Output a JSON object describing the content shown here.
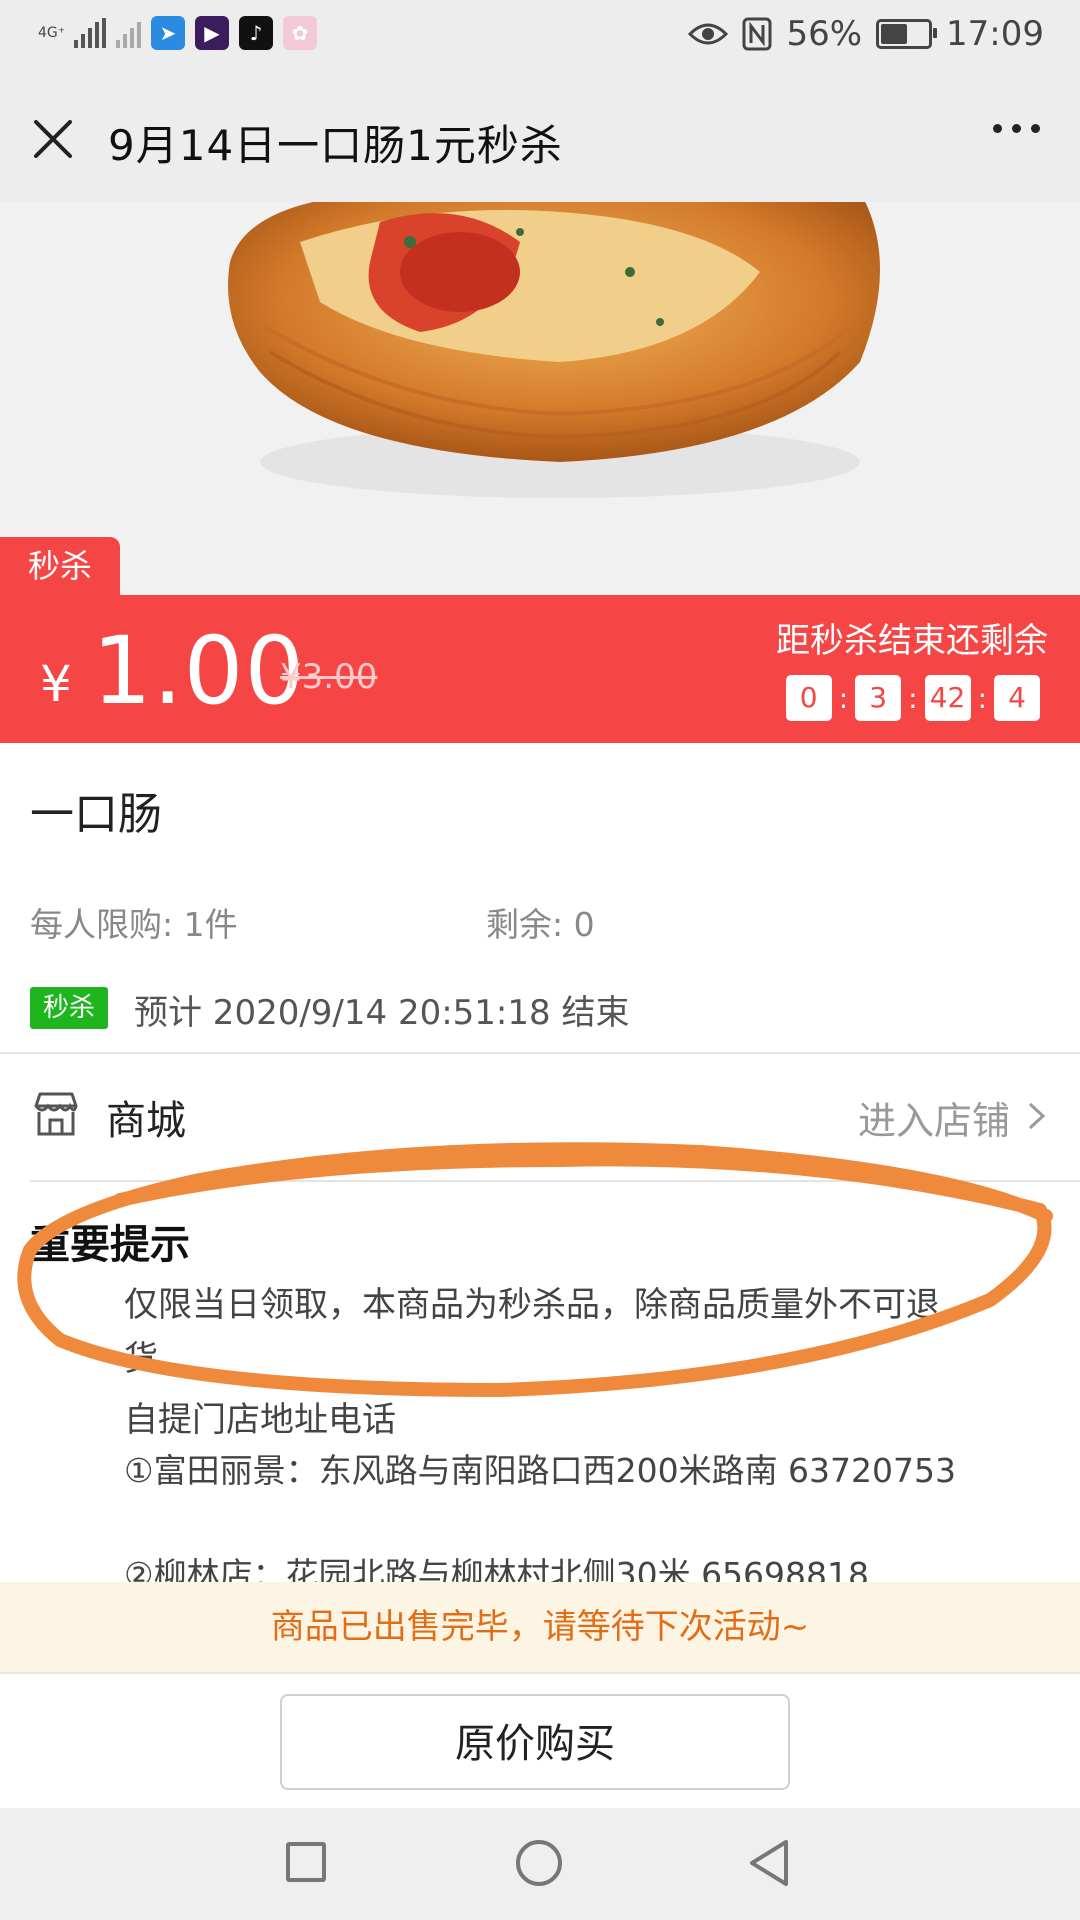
{
  "status_bar": {
    "network_label": "4G⁺",
    "battery": "56%",
    "battery_level": 0.56,
    "time": "17:09",
    "icons": [
      "signal-icon",
      "signal-weak-icon",
      "app-icon-1",
      "app-icon-2",
      "tiktok-icon",
      "app-icon-4",
      "eye-icon",
      "nfc-icon",
      "battery-icon"
    ]
  },
  "header": {
    "title": "9月14日一口肠1元秒杀"
  },
  "seckill_tag": "秒杀",
  "price": {
    "currency": "¥",
    "current": "1.00",
    "original": "¥3.00"
  },
  "countdown": {
    "label": "距秒杀结束还剩余",
    "days": "0",
    "hours": "3",
    "minutes": "42",
    "seconds": "4"
  },
  "product": {
    "name": "一口肠",
    "limit": "每人限购: 1件",
    "remaining": "剩余: 0",
    "tag": "秒杀",
    "end_time": "预计 2020/9/14 20:51:18 结束"
  },
  "shop": {
    "name": "商城",
    "enter": "进入店铺"
  },
  "notice": {
    "title": "重要提示",
    "text": "仅限当日领取，本商品为秒杀品，除商品质量外不可退货。",
    "pickup_title": "自提门店地址电话",
    "stores": [
      "①富田丽景：东风路与南阳路口西200米路南 63720753",
      "②柳林店：花园北路与柳林村北侧30米  65698818"
    ]
  },
  "sold_out_message": "商品已出售完毕，请等待下次活动~",
  "buy_button": "原价购买",
  "colors": {
    "accent_red": "#f64545",
    "green_tag": "#1fb51f",
    "sold_out_text": "#e36d16",
    "annotation_orange": "#ef8a3c"
  }
}
